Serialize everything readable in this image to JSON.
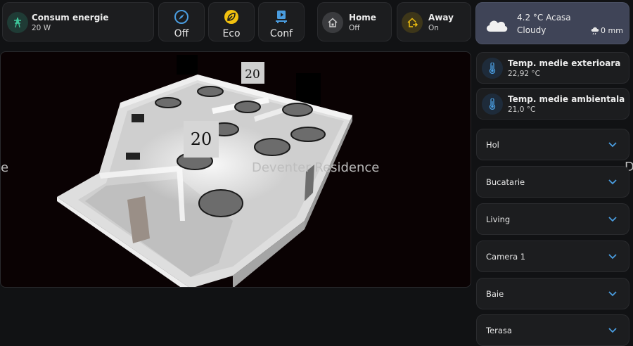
{
  "energy": {
    "title": "Consum energie",
    "value": "20 W",
    "icon": "transmission-tower-icon"
  },
  "modes": [
    {
      "label": "Off",
      "icon": "compass-icon",
      "color": "#4a9de0"
    },
    {
      "label": "Eco",
      "icon": "leaf-icon",
      "color": "#f2c10f"
    },
    {
      "label": "Conf",
      "icon": "sofa-icon",
      "color": "#4a9de0"
    }
  ],
  "presence": [
    {
      "title": "Home",
      "state": "Off",
      "icon": "home-icon"
    },
    {
      "title": "Away",
      "state": "On",
      "icon": "home-export-icon",
      "color": "#f2c10f"
    }
  ],
  "weather": {
    "temp": "4.2 °C Acasa",
    "condition": "Cloudy",
    "precip": "0 mm",
    "icon": "cloudy-icon"
  },
  "floorplan": {
    "residence": "Deventer Residence",
    "left_text": "e",
    "right_text": "D",
    "label_top": "20",
    "label_mid": "20"
  },
  "temps": [
    {
      "title": "Temp. medie exterioara",
      "value": "22,92 °C",
      "icon": "thermometer-icon"
    },
    {
      "title": "Temp. medie ambientala",
      "value": "21,0 °C",
      "icon": "thermometer-icon"
    }
  ],
  "rooms": [
    "Hol",
    "Bucatarie",
    "Living",
    "Camera 1",
    "Baie",
    "Terasa"
  ],
  "colors": {
    "accent": "#4a9de0",
    "warning": "#f2c10f",
    "card": "#1c1d1f",
    "weather_card": "#3f4457"
  }
}
